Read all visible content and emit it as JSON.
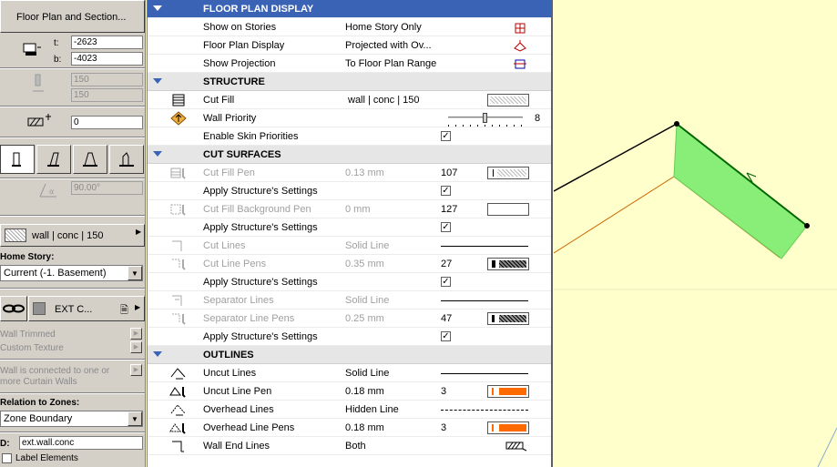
{
  "left": {
    "title_button": "Floor Plan and Section...",
    "t_label": "t:",
    "t_value": "-2623",
    "b_label": "b:",
    "b_value": "-4023",
    "thick1": "150",
    "thick2": "150",
    "offset": "0",
    "angle": "90.00°",
    "composite": "wall | conc | 150",
    "home_story_label": "Home Story:",
    "home_story_value": "Current (-1. Basement)",
    "ext_label": "EXT C...",
    "wall_trimmed": "Wall Trimmed",
    "custom_texture": "Custom Texture",
    "curtain_note_1": "Wall is connected to one or",
    "curtain_note_2": "more Curtain Walls",
    "zones_label": "Relation to Zones:",
    "zones_value": "Zone Boundary",
    "id_label": "D:",
    "id_value": "ext.wall.conc",
    "label_elements": "Label Elements"
  },
  "panel": {
    "header": "FLOOR PLAN DISPLAY",
    "show_on_stories": "Show on Stories",
    "show_on_stories_val": "Home Story Only",
    "floor_plan_display": "Floor Plan Display",
    "floor_plan_display_val": "Projected with Ov...",
    "show_projection": "Show Projection",
    "show_projection_val": "To Floor Plan Range",
    "structure": "STRUCTURE",
    "cut_fill": "Cut Fill",
    "cut_fill_val": "wall | conc | 150",
    "wall_priority": "Wall Priority",
    "wall_priority_val": "8",
    "enable_skin": "Enable Skin Priorities",
    "cut_surfaces": "CUT SURFACES",
    "cut_fill_pen": "Cut Fill Pen",
    "cut_fill_pen_val": "0.13 mm",
    "cut_fill_pen_num": "107",
    "apply_struct": "Apply Structure's Settings",
    "cut_fill_bg_pen": "Cut Fill Background Pen",
    "cut_fill_bg_pen_val": "0 mm",
    "cut_fill_bg_pen_num": "127",
    "cut_lines": "Cut Lines",
    "cut_lines_val": "Solid Line",
    "cut_line_pens": "Cut Line Pens",
    "cut_line_pens_val": "0.35 mm",
    "cut_line_pens_num": "27",
    "separator_lines": "Separator Lines",
    "separator_lines_val": "Solid Line",
    "separator_line_pens": "Separator Line Pens",
    "separator_line_pens_val": "0.25 mm",
    "separator_line_pens_num": "47",
    "outlines": "OUTLINES",
    "uncut_lines": "Uncut Lines",
    "uncut_lines_val": "Solid Line",
    "uncut_line_pen": "Uncut Line Pen",
    "uncut_line_pen_val": "0.18 mm",
    "uncut_line_pen_num": "3",
    "overhead_lines": "Overhead Lines",
    "overhead_lines_val": "Hidden Line",
    "overhead_line_pens": "Overhead Line Pens",
    "overhead_line_pens_val": "0.18 mm",
    "overhead_line_pens_num": "3",
    "wall_end_lines": "Wall End Lines",
    "wall_end_lines_val": "Both"
  },
  "colors": {
    "header_blue": "#3a63b5",
    "orange_pen": "#ff6a00",
    "wall_green": "#88ee77",
    "canvas_bg": "#ffffcc"
  }
}
